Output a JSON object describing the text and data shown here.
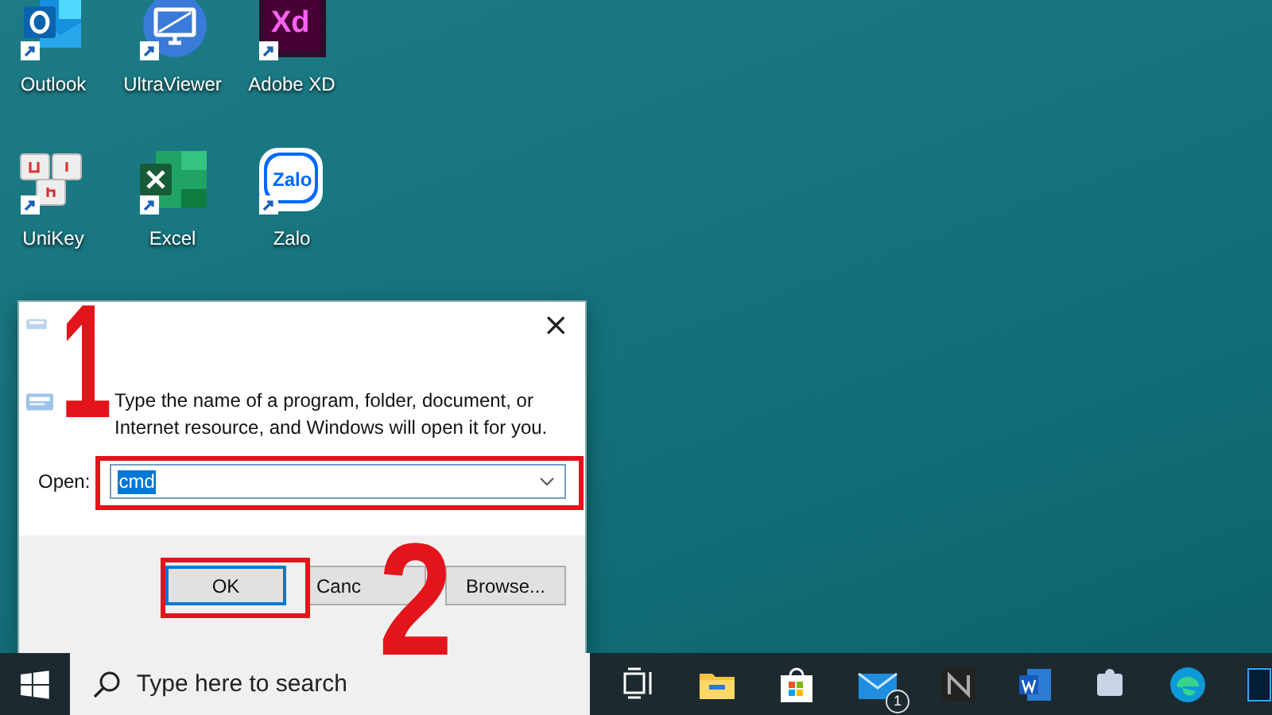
{
  "desktop_icons": [
    {
      "label": "Outlook",
      "kind": "outlook"
    },
    {
      "label": "UltraViewer",
      "kind": "ultraviewer"
    },
    {
      "label": "Adobe XD",
      "kind": "xd",
      "logo_text": "Xd"
    },
    {
      "label": "UniKey",
      "kind": "unikey"
    },
    {
      "label": "Excel",
      "kind": "excel"
    },
    {
      "label": "Zalo",
      "kind": "zalo",
      "logo_text": "Zalo"
    }
  ],
  "run_dialog": {
    "close": "×",
    "description": "Type the name of a program, folder, document, or Internet resource, and Windows will open it for you.",
    "open_label": "Open:",
    "open_value": "cmd",
    "buttons": [
      {
        "label": "OK",
        "focused": true
      },
      {
        "label": "Canc",
        "focused": false
      },
      {
        "label": "Browse...",
        "focused": false
      }
    ]
  },
  "annotations": [
    {
      "label": "1"
    },
    {
      "label": "2"
    }
  ],
  "taskbar": {
    "search_placeholder": "Type here to search",
    "apps": [
      {
        "kind": "task-view"
      },
      {
        "kind": "folder"
      },
      {
        "kind": "store"
      },
      {
        "kind": "mail",
        "badge": "1"
      },
      {
        "kind": "n-app"
      },
      {
        "kind": "word"
      },
      {
        "kind": "puzzle"
      },
      {
        "kind": "edge"
      },
      {
        "kind": "ps"
      }
    ]
  }
}
